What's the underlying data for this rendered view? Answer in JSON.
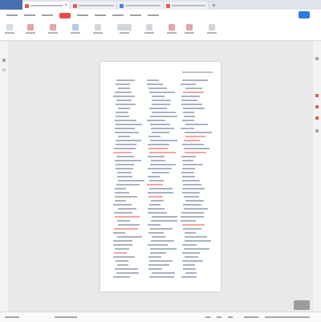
{
  "window": {
    "tabs": [
      {
        "name": "doc-tab-1",
        "color": "#e05a5a",
        "active": true
      },
      {
        "name": "doc-tab-2",
        "color": "#e05a5a",
        "active": false
      },
      {
        "name": "doc-tab-3",
        "color": "#4a7fd8",
        "active": false
      },
      {
        "name": "doc-tab-4",
        "color": "#e05a5a",
        "active": false
      }
    ],
    "new_tab_label": "+"
  },
  "menubar": {
    "active_menu": "home",
    "accent": "#e84a4a",
    "share_color": "#2a7be6"
  },
  "document": {
    "page_count": 1
  },
  "colors": {
    "text_line": "#a9b4c2",
    "highlight": "#f0a7a0",
    "accent": "#e84a4a"
  }
}
